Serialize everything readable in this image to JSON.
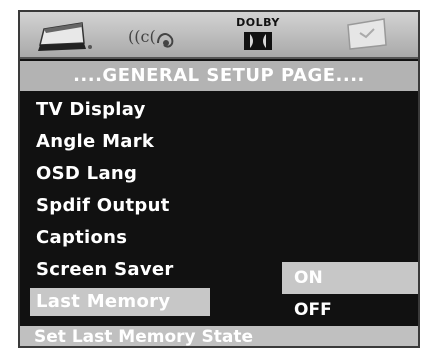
{
  "tabs": [
    {
      "name": "general-setup",
      "icon": "speaker-tv-icon",
      "active": true
    },
    {
      "name": "audio-setup",
      "icon": "audio-waves-icon",
      "active": false
    },
    {
      "name": "dolby-setup",
      "icon": "dolby-logo-icon",
      "label": "DOLBY",
      "active": false
    },
    {
      "name": "preference-setup",
      "icon": "preference-screen-icon",
      "active": false
    }
  ],
  "page_title": "....GENERAL SETUP PAGE....",
  "menu_items": [
    {
      "label": "TV Display",
      "selected": false
    },
    {
      "label": "Angle Mark",
      "selected": false
    },
    {
      "label": "OSD Lang",
      "selected": false
    },
    {
      "label": "Spdif Output",
      "selected": false
    },
    {
      "label": "Captions",
      "selected": false
    },
    {
      "label": "Screen Saver",
      "selected": false
    },
    {
      "label": "Last Memory",
      "selected": true
    }
  ],
  "submenu_options": [
    {
      "label": "ON",
      "highlighted": true
    },
    {
      "label": "OFF",
      "highlighted": false
    }
  ],
  "status_text": "Set Last Memory State",
  "colors": {
    "background": "#111111",
    "header_bar": "#b3b3b3",
    "highlight": "#c7c7c7",
    "text": "#ffffff"
  }
}
